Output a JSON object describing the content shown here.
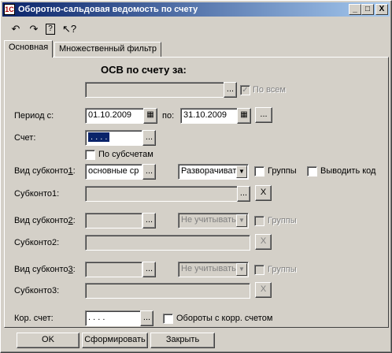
{
  "window": {
    "title": "Оборотно-сальдовая ведомость по счету",
    "app_icon": "1c-icon",
    "minimize": "_",
    "maximize": "□",
    "close": "X"
  },
  "toolbar": {
    "icons": [
      "open-icon",
      "save-icon",
      "help-icon",
      "context-help-icon"
    ]
  },
  "tabs": [
    {
      "label": "Основная",
      "active": true
    },
    {
      "label": "Множественный фильтр",
      "active": false
    }
  ],
  "form": {
    "heading": "ОСВ по счету за:",
    "period_select": {
      "value": "",
      "button": "..."
    },
    "all_checkbox": {
      "label": "По всем",
      "checked": true,
      "disabled": true
    },
    "period_from_label": "Период с:",
    "period_from": "01.10.2009",
    "period_to_label": "по:",
    "period_to": "31.10.2009",
    "period_button": "...",
    "account_label": "Счет:",
    "account_value": ". . . .",
    "account_button": "...",
    "subaccounts_checkbox": {
      "label": "По субсчетам",
      "checked": false
    },
    "subconto1_type_label": "Вид субконто1:",
    "subconto1_type": "основные ср",
    "subconto1_type_button": "...",
    "subconto1_mode": "Разворачиват",
    "subconto1_groups": {
      "label": "Группы",
      "checked": false
    },
    "show_code": {
      "label": "Выводить код",
      "checked": false
    },
    "subconto1_label": "Субконто1:",
    "subconto1_value": "",
    "subconto1_button": "...",
    "subconto1_clear": "X",
    "subconto2_type_label": "Вид субконто2:",
    "subconto2_type": "",
    "subconto2_type_button": "...",
    "subconto2_mode": "Не учитывать",
    "subconto2_groups": {
      "label": "Группы",
      "checked": false
    },
    "subconto2_label": "Субконто2:",
    "subconto2_value": "",
    "subconto2_button": "...",
    "subconto2_clear": "X",
    "subconto3_type_label": "Вид субконто3:",
    "subconto3_type": "",
    "subconto3_type_button": "...",
    "subconto3_mode": "Не учитывать",
    "subconto3_groups": {
      "label": "Группы",
      "checked": false
    },
    "subconto3_label": "Субконто3:",
    "subconto3_value": "",
    "subconto3_button": "...",
    "subconto3_clear": "X",
    "corr_account_label": "Кор. счет:",
    "corr_account_value": ". . . .",
    "corr_account_button": "...",
    "corr_turnovers": {
      "label": "Обороты с корр. счетом",
      "checked": false
    }
  },
  "buttons": {
    "ok": "OK",
    "generate": "Сформировать",
    "close": "Закрыть"
  },
  "colors": {
    "title_active": "#0a246a",
    "selection": "#0a246a",
    "face": "#d4d0c8"
  }
}
